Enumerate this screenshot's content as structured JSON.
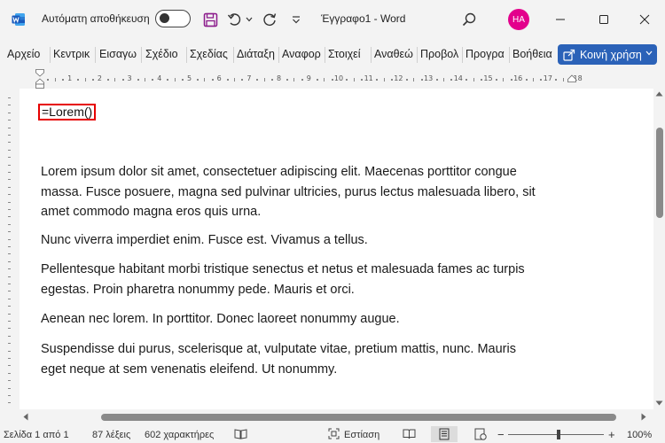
{
  "titlebar": {
    "autosave_label": "Αυτόματη αποθήκευση",
    "document_title": "Έγγραφο1 - Word",
    "user_initials": "HA",
    "avatar_color": "#e3008c"
  },
  "ribbon": {
    "tabs": [
      "Αρχείο",
      "Κεντρικ",
      "Εισαγω",
      "Σχέδιο",
      "Σχεδίας",
      "Διάταξη",
      "Αναφορ",
      "Στοιχεί",
      "Αναθεώ",
      "Προβολ",
      "Προγρα",
      "Βοήθεια"
    ],
    "share_label": "Κοινή χρήση",
    "share_color": "#2b62b8"
  },
  "ruler": {
    "numbers": [
      "1",
      "2",
      "3",
      "4",
      "5",
      "6",
      "7",
      "8",
      "9",
      "10",
      "11",
      "12",
      "13",
      "14",
      "15",
      "16",
      "17",
      "18"
    ]
  },
  "document": {
    "formula": "=Lorem()",
    "paragraphs": [
      [
        "Lorem ipsum dolor sit amet, consectetuer adipiscing elit. Maecenas porttitor congue",
        "massa. Fusce posuere, magna sed pulvinar ultricies, purus lectus malesuada libero, sit",
        "amet commodo magna eros quis urna."
      ],
      [
        "Nunc viverra imperdiet enim. Fusce est. Vivamus a tellus."
      ],
      [
        "Pellentesque habitant morbi tristique senectus et netus et malesuada fames ac turpis",
        "egestas. Proin pharetra nonummy pede. Mauris et orci."
      ],
      [
        "Aenean nec lorem. In porttitor. Donec laoreet nonummy augue."
      ],
      [
        "Suspendisse dui purus, scelerisque at, vulputate vitae, pretium mattis, nunc. Mauris",
        "eget neque at sem venenatis eleifend. Ut nonummy."
      ]
    ]
  },
  "statusbar": {
    "page": "Σελίδα 1 από 1",
    "words": "87 λέξεις",
    "characters": "602 χαρακτήρες",
    "focus_label": "Εστίαση",
    "zoom_minus": "−",
    "zoom_plus": "+",
    "zoom": "100%"
  }
}
